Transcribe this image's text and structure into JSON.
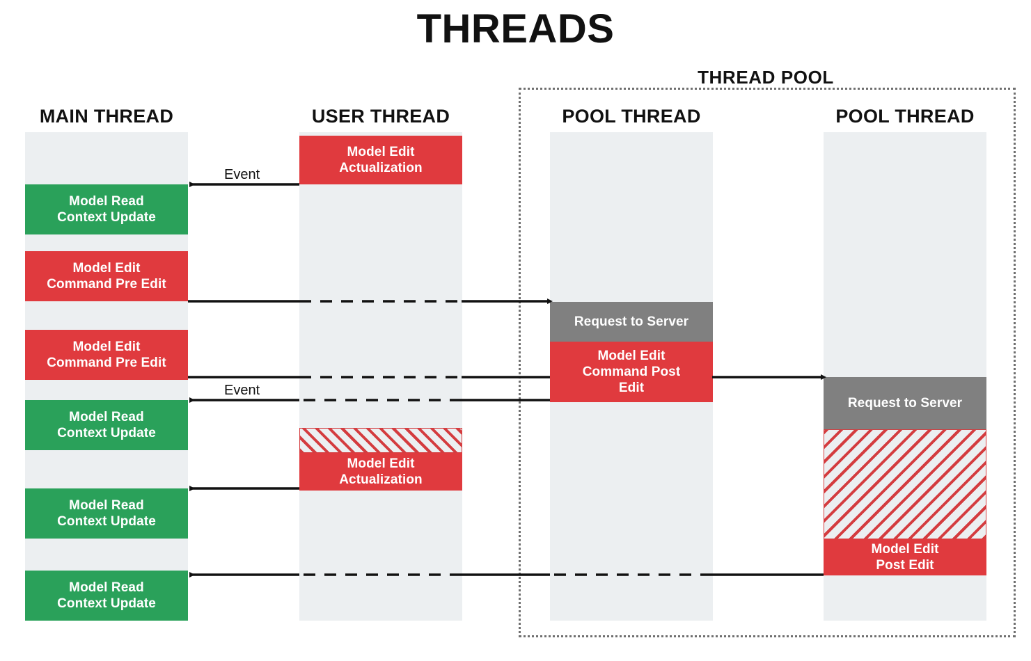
{
  "title": "THREADS",
  "pool_group": {
    "label": "THREAD POOL"
  },
  "lanes": [
    {
      "id": "main",
      "header": "MAIN THREAD"
    },
    {
      "id": "user",
      "header": "USER THREAD"
    },
    {
      "id": "pool1",
      "header": "POOL THREAD"
    },
    {
      "id": "pool2",
      "header": "POOL THREAD"
    }
  ],
  "blocks": {
    "main": [
      {
        "label": "Model Read\nContext Update",
        "kind": "green"
      },
      {
        "label": "Model Edit\nCommand Pre Edit",
        "kind": "red"
      },
      {
        "label": "Model Edit\nCommand Pre Edit",
        "kind": "red"
      },
      {
        "label": "Model Read\nContext Update",
        "kind": "green"
      },
      {
        "label": "Model Read\nContext Update",
        "kind": "green"
      },
      {
        "label": "Model Read\nContext Update",
        "kind": "green"
      }
    ],
    "user": [
      {
        "label": "Model Edit\nActualization",
        "kind": "red"
      },
      {
        "label": "",
        "kind": "hatch-up"
      },
      {
        "label": "Model Edit\nActualization",
        "kind": "red"
      }
    ],
    "pool1": [
      {
        "label": "Request to Server",
        "kind": "gray"
      },
      {
        "label": "Model Edit\nCommand Post\nEdit",
        "kind": "red"
      }
    ],
    "pool2": [
      {
        "label": "Request to Server",
        "kind": "gray"
      },
      {
        "label": "",
        "kind": "hatch-down"
      },
      {
        "label": "Model Edit\nPost Edit",
        "kind": "red"
      }
    ]
  },
  "arrow_labels": [
    {
      "text": "Event"
    },
    {
      "text": "Event"
    }
  ],
  "colors": {
    "red": "#e03a3e",
    "green": "#2aa15a",
    "gray": "#808080",
    "lane": "#eceff1",
    "line": "#111111",
    "pool_border": "#6f6f6f"
  }
}
